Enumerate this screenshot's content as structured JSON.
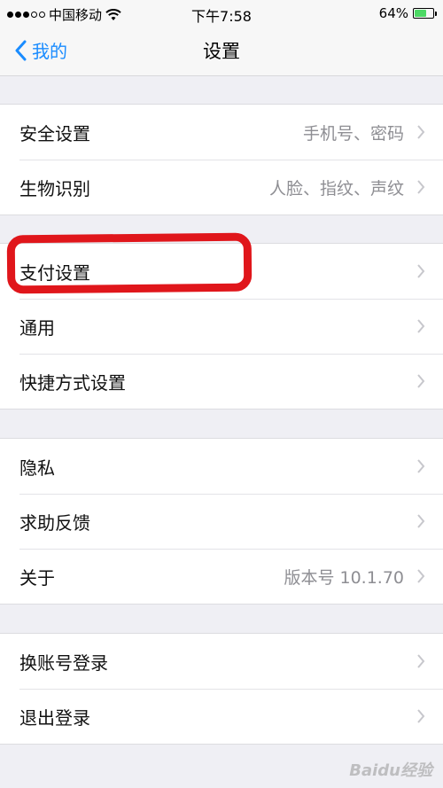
{
  "status_bar": {
    "carrier": "中国移动",
    "signal_dots_filled": 3,
    "signal_dots_total": 5,
    "time": "下午7:58",
    "battery_percent": "64%",
    "battery_level": 0.64,
    "battery_color": "#4cd964"
  },
  "nav": {
    "back_label": "我的",
    "title": "设置",
    "accent_color": "#1a8cff"
  },
  "groups": [
    [
      {
        "label": "安全设置",
        "value": "手机号、密码"
      },
      {
        "label": "生物识别",
        "value": "人脸、指纹、声纹"
      }
    ],
    [
      {
        "label": "支付设置",
        "value": ""
      },
      {
        "label": "通用",
        "value": ""
      },
      {
        "label": "快捷方式设置",
        "value": ""
      }
    ],
    [
      {
        "label": "隐私",
        "value": ""
      },
      {
        "label": "求助反馈",
        "value": ""
      },
      {
        "label": "关于",
        "value": "版本号 10.1.70"
      }
    ],
    [
      {
        "label": "换账号登录",
        "value": ""
      },
      {
        "label": "退出登录",
        "value": ""
      }
    ]
  ],
  "highlight_color": "#e0161b",
  "watermark": "Baidu经验"
}
